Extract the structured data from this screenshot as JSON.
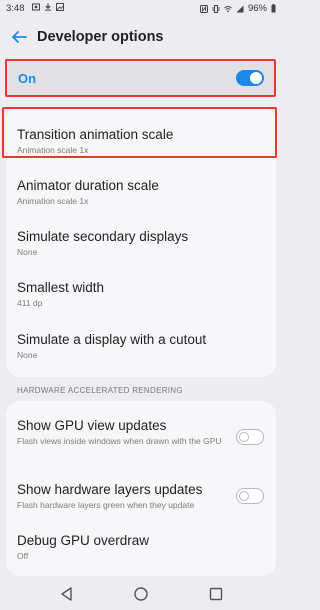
{
  "status_bar": {
    "time": "3:48",
    "battery": "96%",
    "left_icons": [
      "photo-icon",
      "download-icon",
      "image-icon"
    ],
    "right_icons": [
      "nfc-icon",
      "vibrate-icon",
      "wifi-icon",
      "signal-icon",
      "battery-icon"
    ]
  },
  "app_bar": {
    "title": "Developer options",
    "back_icon": "back-arrow-icon"
  },
  "master_switch": {
    "label": "On",
    "state": "on",
    "accent_color": "#1e88e5"
  },
  "settings": [
    {
      "title": "Transition animation scale",
      "subtitle": "Animation scale 1x"
    },
    {
      "title": "Animator duration scale",
      "subtitle": "Animation scale 1x"
    },
    {
      "title": "Simulate secondary displays",
      "subtitle": "None"
    },
    {
      "title": "Smallest width",
      "subtitle": "411 dp"
    },
    {
      "title": "Simulate a display with a cutout",
      "subtitle": "None"
    }
  ],
  "section_header": "HARDWARE ACCELERATED RENDERING",
  "hw_settings": [
    {
      "title": "Show GPU view updates",
      "subtitle": "Flash views inside windows when drawn with the GPU",
      "toggle": "off"
    },
    {
      "title": "Show hardware layers updates",
      "subtitle": "Flash hardware layers green when they update",
      "toggle": "off"
    },
    {
      "title": "Debug GPU overdraw",
      "subtitle": "Off"
    }
  ],
  "nav_bar": {
    "buttons": [
      "back-triangle-icon",
      "home-circle-icon",
      "recents-square-icon"
    ]
  },
  "colors": {
    "highlight": "#e53935",
    "background": "#ededf1",
    "card": "#f7f7f9"
  }
}
